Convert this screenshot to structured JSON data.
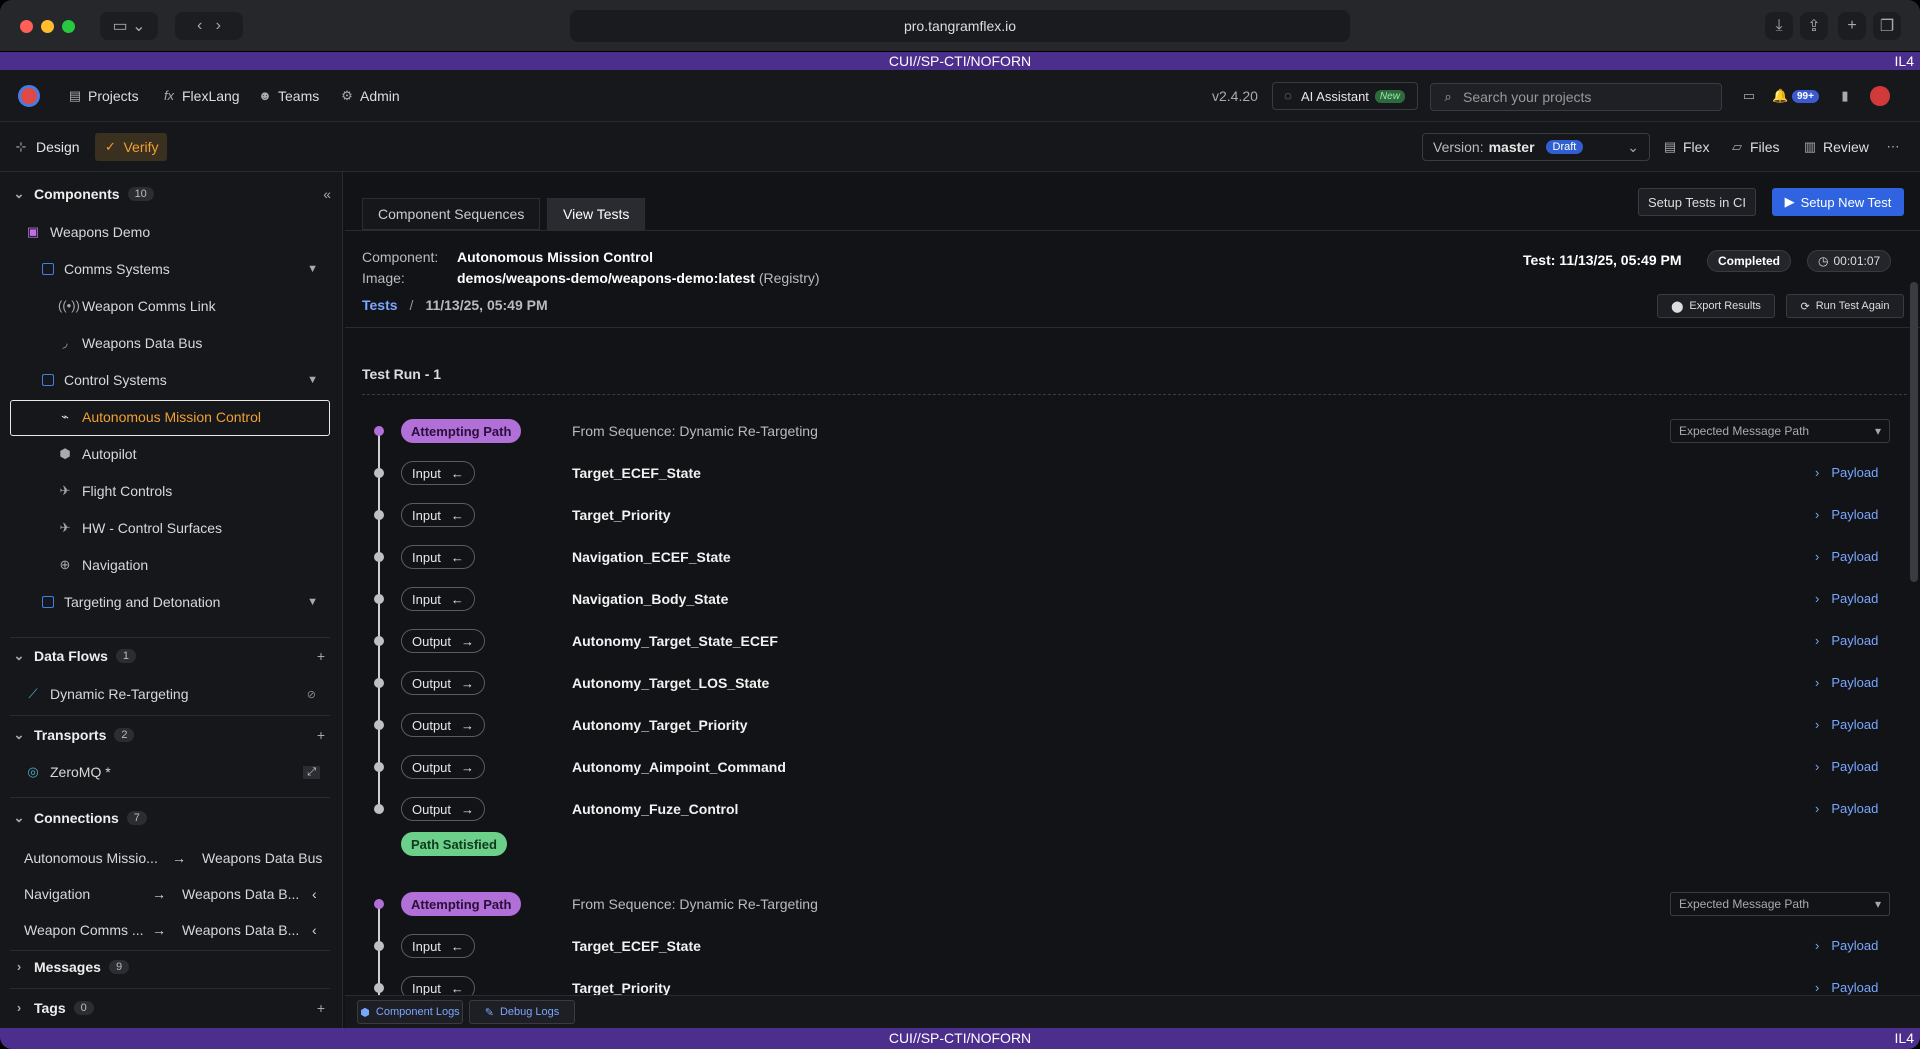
{
  "browser": {
    "url": "pro.tangramflex.io"
  },
  "banner": {
    "text": "CUI//SP-CTI/NOFORN",
    "level": "IL4"
  },
  "nav": {
    "items": [
      {
        "label": "Projects",
        "icon": "projects-icon"
      },
      {
        "label": "FlexLang",
        "icon": "fx-icon"
      },
      {
        "label": "Teams",
        "icon": "teams-icon"
      },
      {
        "label": "Admin",
        "icon": "gear-icon"
      }
    ],
    "version": "v2.4.20",
    "ai_label": "AI Assistant",
    "ai_badge": "New",
    "search_placeholder": "Search your projects",
    "notif_count": "99+"
  },
  "toolbar": {
    "design": "Design",
    "verify": "Verify",
    "version_label": "Version:",
    "version_value": "master",
    "draft": "Draft",
    "flex": "Flex",
    "files": "Files",
    "review": "Review"
  },
  "sidebar": {
    "components": {
      "title": "Components",
      "count": "10",
      "project": "Weapons Demo",
      "groups": [
        {
          "name": "Comms Systems",
          "children": [
            "Weapon Comms Link",
            "Weapons Data Bus"
          ]
        },
        {
          "name": "Control Systems",
          "children": [
            "Autonomous Mission Control",
            "Autopilot",
            "Flight Controls",
            "HW - Control Surfaces",
            "Navigation"
          ]
        },
        {
          "name": "Targeting and Detonation",
          "children": []
        }
      ]
    },
    "data_flows": {
      "title": "Data Flows",
      "count": "1",
      "items": [
        "Dynamic Re-Targeting"
      ]
    },
    "transports": {
      "title": "Transports",
      "count": "2",
      "items": [
        "ZeroMQ *"
      ]
    },
    "connections": {
      "title": "Connections",
      "count": "7",
      "items": [
        {
          "from": "Autonomous Missio...",
          "to": "Weapons Data Bus"
        },
        {
          "from": "Navigation",
          "to": "Weapons Data B..."
        },
        {
          "from": "Weapon Comms ...",
          "to": "Weapons Data B..."
        }
      ]
    },
    "messages": {
      "title": "Messages",
      "count": "9"
    },
    "tags": {
      "title": "Tags",
      "count": "0"
    }
  },
  "main": {
    "tabs": [
      "Component Sequences",
      "View Tests"
    ],
    "setup_ci": "Setup Tests in CI",
    "setup_new": "Setup New Test",
    "component_label": "Component:",
    "component_value": "Autonomous Mission Control",
    "image_label": "Image:",
    "image_value": "demos/weapons-demo/weapons-demo:latest",
    "image_suffix": "(Registry)",
    "test_label": "Test: 11/13/25, 05:49 PM",
    "status": "Completed",
    "duration": "00:01:07",
    "breadcrumb_tests": "Tests",
    "breadcrumb_sep": "/",
    "breadcrumb_current": "11/13/25, 05:49 PM",
    "export": "Export Results",
    "run_again": "Run Test Again",
    "run_title": "Test Run - 1",
    "attempting": "Attempting Path",
    "from_sequence": "From Sequence: Dynamic Re-Targeting",
    "expected_select": "Expected Message Path",
    "satisfied": "Path Satisfied",
    "payload": "Payload",
    "path1": [
      {
        "dir": "Input",
        "name": "Target_ECEF_State"
      },
      {
        "dir": "Input",
        "name": "Target_Priority"
      },
      {
        "dir": "Input",
        "name": "Navigation_ECEF_State"
      },
      {
        "dir": "Input",
        "name": "Navigation_Body_State"
      },
      {
        "dir": "Output",
        "name": "Autonomy_Target_State_ECEF"
      },
      {
        "dir": "Output",
        "name": "Autonomy_Target_LOS_State"
      },
      {
        "dir": "Output",
        "name": "Autonomy_Target_Priority"
      },
      {
        "dir": "Output",
        "name": "Autonomy_Aimpoint_Command"
      },
      {
        "dir": "Output",
        "name": "Autonomy_Fuze_Control"
      }
    ],
    "path2": [
      {
        "dir": "Input",
        "name": "Target_ECEF_State"
      },
      {
        "dir": "Input",
        "name": "Target_Priority"
      }
    ],
    "component_logs": "Component Logs",
    "debug_logs": "Debug Logs"
  },
  "colors": {
    "accent": "#4a7be0",
    "banner": "#4c2e8c",
    "attempt": "#b16fd8",
    "satisfied": "#6cd08a",
    "link": "#7aa6ff",
    "selected": "#f0a030"
  }
}
